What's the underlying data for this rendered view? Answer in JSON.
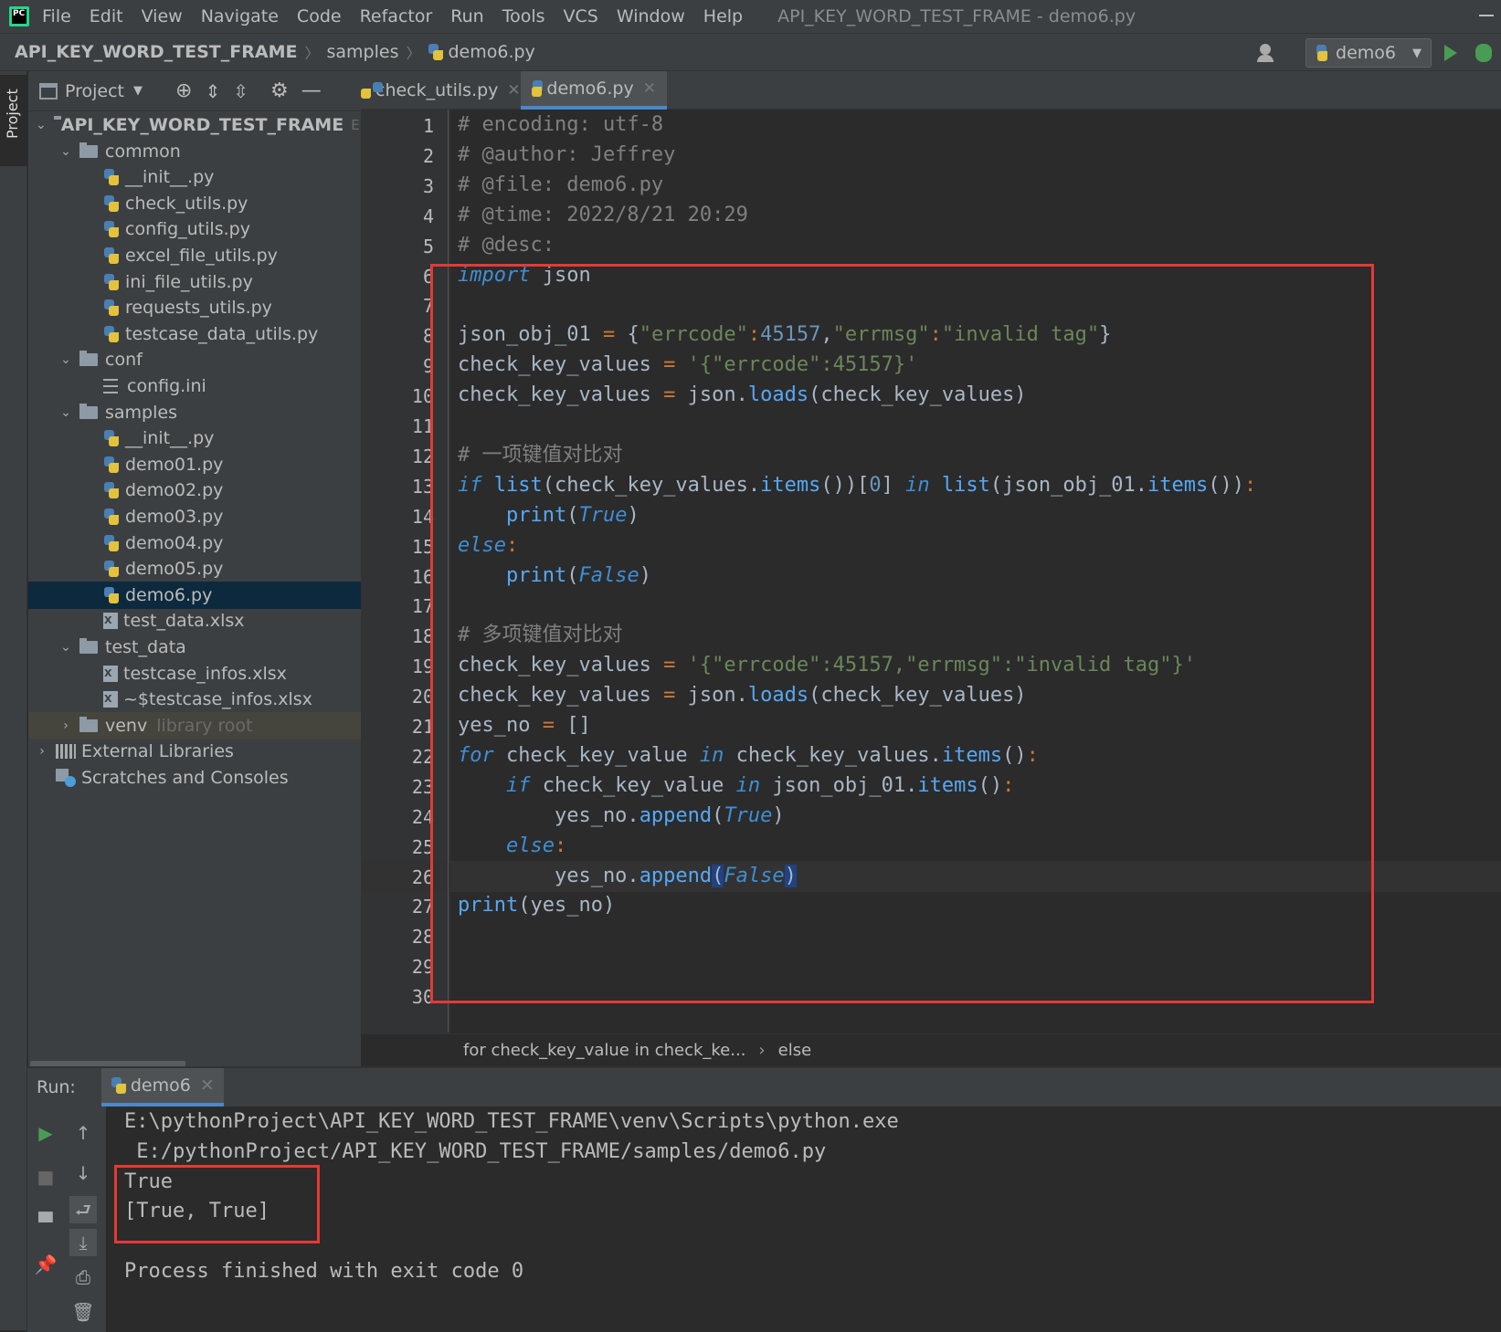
{
  "menubar": {
    "app_icon_label": "PC",
    "items": [
      "File",
      "Edit",
      "View",
      "Navigate",
      "Code",
      "Refactor",
      "Run",
      "Tools",
      "VCS",
      "Window",
      "Help"
    ],
    "window_title": "API_KEY_WORD_TEST_FRAME - demo6.py"
  },
  "navbar": {
    "crumbs": [
      "API_KEY_WORD_TEST_FRAME",
      "samples",
      "demo6.py"
    ],
    "run_config": "demo6"
  },
  "left_strip": {
    "project_tab": "Project"
  },
  "project_panel": {
    "header": "Project",
    "tree": [
      {
        "label": "API_KEY_WORD_TEST_FRAME",
        "suffix": "E:\\",
        "type": "root",
        "depth": 0,
        "arrow": "v"
      },
      {
        "label": "common",
        "type": "folder",
        "depth": 1,
        "arrow": "v"
      },
      {
        "label": "__init__.py",
        "type": "py",
        "depth": 2
      },
      {
        "label": "check_utils.py",
        "type": "py",
        "depth": 2
      },
      {
        "label": "config_utils.py",
        "type": "py",
        "depth": 2
      },
      {
        "label": "excel_file_utils.py",
        "type": "py",
        "depth": 2
      },
      {
        "label": "ini_file_utils.py",
        "type": "py",
        "depth": 2
      },
      {
        "label": "requests_utils.py",
        "type": "py",
        "depth": 2
      },
      {
        "label": "testcase_data_utils.py",
        "type": "py",
        "depth": 2
      },
      {
        "label": "conf",
        "type": "folder",
        "depth": 1,
        "arrow": "v"
      },
      {
        "label": "config.ini",
        "type": "ini",
        "depth": 2
      },
      {
        "label": "samples",
        "type": "folder",
        "depth": 1,
        "arrow": "v"
      },
      {
        "label": "__init__.py",
        "type": "py",
        "depth": 2
      },
      {
        "label": "demo01.py",
        "type": "py",
        "depth": 2
      },
      {
        "label": "demo02.py",
        "type": "py",
        "depth": 2
      },
      {
        "label": "demo03.py",
        "type": "py",
        "depth": 2
      },
      {
        "label": "demo04.py",
        "type": "py",
        "depth": 2
      },
      {
        "label": "demo05.py",
        "type": "py",
        "depth": 2
      },
      {
        "label": "demo6.py",
        "type": "py",
        "depth": 2,
        "selected": true
      },
      {
        "label": "test_data.xlsx",
        "type": "xlsx",
        "depth": 2
      },
      {
        "label": "test_data",
        "type": "folder",
        "depth": 1,
        "arrow": "v"
      },
      {
        "label": "testcase_infos.xlsx",
        "type": "xlsx",
        "depth": 2
      },
      {
        "label": "~$testcase_infos.xlsx",
        "type": "xlsx",
        "depth": 2
      },
      {
        "label": "venv",
        "suffix": "library root",
        "type": "folder",
        "depth": 1,
        "arrow": ">",
        "venv": true
      },
      {
        "label": "External Libraries",
        "type": "lib",
        "depth": 0,
        "arrow": ">"
      },
      {
        "label": "Scratches and Consoles",
        "type": "scratch",
        "depth": 0
      }
    ]
  },
  "editor": {
    "tabs": [
      {
        "label": "check_utils.py",
        "active": false
      },
      {
        "label": "demo6.py",
        "active": true
      }
    ],
    "current_line": 26,
    "lines": [
      [
        [
          "cm",
          "# encoding: utf-8"
        ]
      ],
      [
        [
          "cm",
          "# @author: Jeffrey"
        ]
      ],
      [
        [
          "cm",
          "# @file: demo6.py"
        ]
      ],
      [
        [
          "cm",
          "# @time: 2022/8/21 20:29"
        ]
      ],
      [
        [
          "cm",
          "# @desc:"
        ]
      ],
      [
        [
          "kwb",
          "import"
        ],
        [
          "pl",
          " json"
        ]
      ],
      [],
      [
        [
          "pl",
          "json_obj_01 "
        ],
        [
          "op",
          "="
        ],
        [
          "pl",
          " {"
        ],
        [
          "st",
          "\"errcode\""
        ],
        [
          "op",
          ":"
        ],
        [
          "nm",
          "45157"
        ],
        [
          "pl",
          ","
        ],
        [
          "st",
          "\"errmsg\""
        ],
        [
          "op",
          ":"
        ],
        [
          "st",
          "\"invalid tag\""
        ],
        [
          "pl",
          "}"
        ]
      ],
      [
        [
          "pl",
          "check_key_values "
        ],
        [
          "op",
          "="
        ],
        [
          "st",
          " '{\"errcode\":45157}'"
        ]
      ],
      [
        [
          "pl",
          "check_key_values "
        ],
        [
          "op",
          "="
        ],
        [
          "pl",
          " json."
        ],
        [
          "fn",
          "loads"
        ],
        [
          "pl",
          "(check_key_values)"
        ]
      ],
      [],
      [
        [
          "cm",
          "# 一项键值对比对"
        ]
      ],
      [
        [
          "kwb",
          "if"
        ],
        [
          "pl",
          " "
        ],
        [
          "fn",
          "list"
        ],
        [
          "pl",
          "(check_key_values."
        ],
        [
          "fn",
          "items"
        ],
        [
          "pl",
          "())["
        ],
        [
          "nm",
          "0"
        ],
        [
          "pl",
          "] "
        ],
        [
          "kwb",
          "in"
        ],
        [
          "pl",
          " "
        ],
        [
          "fn",
          "list"
        ],
        [
          "pl",
          "(json_obj_01."
        ],
        [
          "fn",
          "items"
        ],
        [
          "pl",
          "())"
        ],
        [
          "op",
          ":"
        ]
      ],
      [
        [
          "pl",
          "    "
        ],
        [
          "fn",
          "print"
        ],
        [
          "pl",
          "("
        ],
        [
          "kwb",
          "True"
        ],
        [
          "pl",
          ")"
        ]
      ],
      [
        [
          "kwb",
          "else"
        ],
        [
          "op",
          ":"
        ]
      ],
      [
        [
          "pl",
          "    "
        ],
        [
          "fn",
          "print"
        ],
        [
          "pl",
          "("
        ],
        [
          "kwb",
          "False"
        ],
        [
          "pl",
          ")"
        ]
      ],
      [],
      [
        [
          "cm",
          "# 多项键值对比对"
        ]
      ],
      [
        [
          "pl",
          "check_key_values "
        ],
        [
          "op",
          "="
        ],
        [
          "st",
          " '{\"errcode\":45157,\"errmsg\":\"invalid tag\"}'"
        ]
      ],
      [
        [
          "pl",
          "check_key_values "
        ],
        [
          "op",
          "="
        ],
        [
          "pl",
          " json."
        ],
        [
          "fn",
          "loads"
        ],
        [
          "pl",
          "(check_key_values)"
        ]
      ],
      [
        [
          "pl",
          "yes_no "
        ],
        [
          "op",
          "="
        ],
        [
          "pl",
          " []"
        ]
      ],
      [
        [
          "kwb",
          "for"
        ],
        [
          "pl",
          " check_key_value "
        ],
        [
          "kwb",
          "in"
        ],
        [
          "pl",
          " check_key_values."
        ],
        [
          "fn",
          "items"
        ],
        [
          "pl",
          "()"
        ],
        [
          "op",
          ":"
        ]
      ],
      [
        [
          "pl",
          "    "
        ],
        [
          "kwb",
          "if"
        ],
        [
          "pl",
          " check_key_value "
        ],
        [
          "kwb",
          "in"
        ],
        [
          "pl",
          " json_obj_01."
        ],
        [
          "fn",
          "items"
        ],
        [
          "pl",
          "()"
        ],
        [
          "op",
          ":"
        ]
      ],
      [
        [
          "pl",
          "        yes_no."
        ],
        [
          "fn",
          "append"
        ],
        [
          "pl",
          "("
        ],
        [
          "kwb",
          "True"
        ],
        [
          "pl",
          ")"
        ]
      ],
      [
        [
          "pl",
          "    "
        ],
        [
          "kwb",
          "else"
        ],
        [
          "op",
          ":"
        ]
      ],
      [
        [
          "pl",
          "        yes_no."
        ],
        [
          "fn",
          "append"
        ],
        [
          "hl",
          "("
        ],
        [
          "kwb",
          "False"
        ],
        [
          "hl",
          ")"
        ]
      ],
      [
        [
          "fn",
          "print"
        ],
        [
          "pl",
          "(yes_no)"
        ]
      ],
      [],
      [],
      []
    ],
    "breadcrumb": [
      "for check_key_value in check_ke...",
      "else"
    ]
  },
  "run": {
    "label": "Run:",
    "tab": "demo6",
    "console": [
      "E:\\pythonProject\\API_KEY_WORD_TEST_FRAME\\venv\\Scripts\\python.exe",
      " E:/pythonProject/API_KEY_WORD_TEST_FRAME/samples/demo6.py",
      "True",
      "[True, True]",
      "",
      "Process finished with exit code 0"
    ]
  }
}
